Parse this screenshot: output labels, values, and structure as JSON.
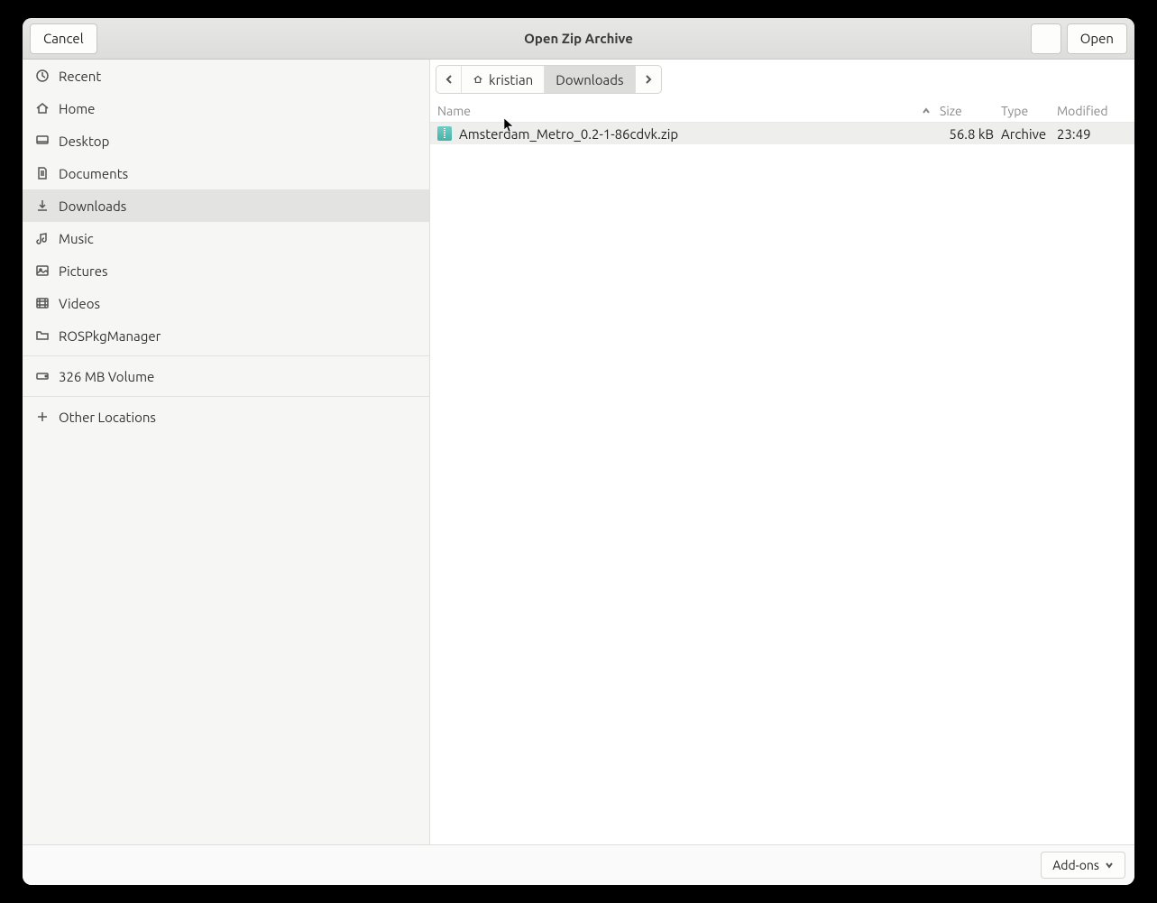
{
  "header": {
    "cancel_label": "Cancel",
    "title": "Open Zip Archive",
    "open_label": "Open"
  },
  "sidebar": {
    "items": [
      {
        "id": "recent",
        "label": "Recent",
        "icon": "clock-icon"
      },
      {
        "id": "home",
        "label": "Home",
        "icon": "home-icon"
      },
      {
        "id": "desktop",
        "label": "Desktop",
        "icon": "desktop-icon"
      },
      {
        "id": "documents",
        "label": "Documents",
        "icon": "document-icon"
      },
      {
        "id": "downloads",
        "label": "Downloads",
        "icon": "download-icon",
        "selected": true
      },
      {
        "id": "music",
        "label": "Music",
        "icon": "music-icon"
      },
      {
        "id": "pictures",
        "label": "Pictures",
        "icon": "picture-icon"
      },
      {
        "id": "videos",
        "label": "Videos",
        "icon": "video-icon"
      },
      {
        "id": "rospkgmanager",
        "label": "ROSPkgManager",
        "icon": "folder-icon"
      }
    ],
    "volumes": [
      {
        "id": "vol326",
        "label": "326 MB Volume",
        "icon": "drive-icon"
      }
    ],
    "other_label": "Other Locations"
  },
  "pathbar": {
    "segments": [
      {
        "id": "home",
        "label": "kristian",
        "icon": "home-icon"
      },
      {
        "id": "downloads",
        "label": "Downloads",
        "active": true
      }
    ]
  },
  "columns": {
    "name": "Name",
    "size": "Size",
    "type": "Type",
    "modified": "Modified"
  },
  "files": [
    {
      "name": "Amsterdam_Metro_0.2-1-86cdvk.zip",
      "size": "56.8 kB",
      "type": "Archive",
      "modified": "23:49",
      "selected": true
    }
  ],
  "footer": {
    "addons_label": "Add-ons"
  }
}
